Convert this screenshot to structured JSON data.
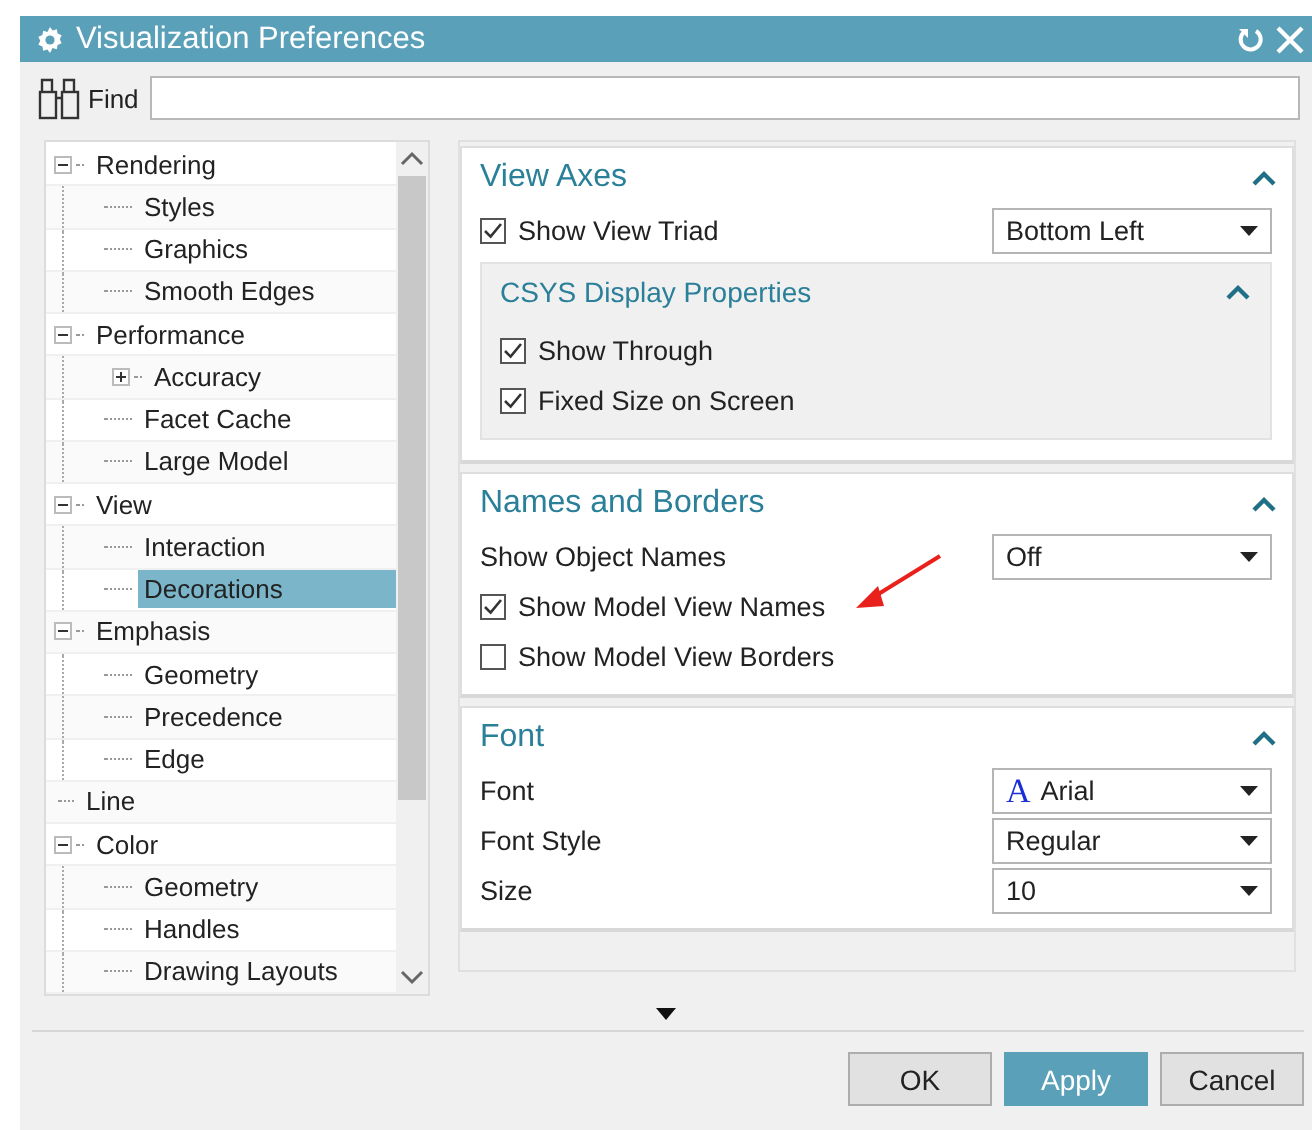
{
  "window": {
    "title": "Visualization Preferences"
  },
  "find": {
    "label": "Find"
  },
  "tree": [
    {
      "label": "Rendering",
      "expanded": true,
      "selected": false,
      "children": [
        {
          "label": "Styles",
          "selected": false
        },
        {
          "label": "Graphics",
          "selected": false
        },
        {
          "label": "Smooth Edges",
          "selected": false
        }
      ]
    },
    {
      "label": "Performance",
      "expanded": true,
      "selected": false,
      "children": [
        {
          "label": "Accuracy",
          "expanded": false,
          "selected": false
        },
        {
          "label": "Facet Cache",
          "selected": false
        },
        {
          "label": "Large Model",
          "selected": false
        }
      ]
    },
    {
      "label": "View",
      "expanded": true,
      "selected": false,
      "children": [
        {
          "label": "Interaction",
          "selected": false
        },
        {
          "label": "Decorations",
          "selected": true
        }
      ]
    },
    {
      "label": "Emphasis",
      "expanded": true,
      "selected": false,
      "children": [
        {
          "label": "Geometry",
          "selected": false
        },
        {
          "label": "Precedence",
          "selected": false
        },
        {
          "label": "Edge",
          "selected": false
        }
      ]
    },
    {
      "label": "Line",
      "selected": false
    },
    {
      "label": "Color",
      "expanded": true,
      "selected": false,
      "children": [
        {
          "label": "Geometry",
          "selected": false
        },
        {
          "label": "Handles",
          "selected": false
        },
        {
          "label": "Drawing Layouts",
          "selected": false
        }
      ]
    }
  ],
  "sections": [
    {
      "title": "View Axes",
      "expanded": true,
      "rows": [
        {
          "kind": "checkselect",
          "label": "Show View Triad",
          "checked": true,
          "value": "Bottom Left"
        }
      ],
      "subsection": {
        "title": "CSYS Display Properties",
        "expanded": true,
        "rows": [
          {
            "kind": "checkbox",
            "label": "Show Through",
            "checked": true
          },
          {
            "kind": "checkbox",
            "label": "Fixed Size on Screen",
            "checked": true
          }
        ]
      }
    },
    {
      "title": "Names and Borders",
      "expanded": true,
      "rows": [
        {
          "kind": "select",
          "label": "Show Object Names",
          "value": "Off"
        },
        {
          "kind": "checkbox",
          "label": "Show Model View Names",
          "checked": true
        },
        {
          "kind": "checkbox",
          "label": "Show Model View Borders",
          "checked": false
        }
      ]
    },
    {
      "title": "Font",
      "expanded": true,
      "rows": [
        {
          "kind": "select",
          "label": "Font",
          "value": "Arial",
          "icon": "A"
        },
        {
          "kind": "select",
          "label": "Font Style",
          "value": "Regular"
        },
        {
          "kind": "select",
          "label": "Size",
          "value": "10"
        }
      ]
    }
  ],
  "buttons": [
    {
      "label": "OK",
      "default": false
    },
    {
      "label": "Apply",
      "default": true
    },
    {
      "label": "Cancel",
      "default": false
    }
  ]
}
